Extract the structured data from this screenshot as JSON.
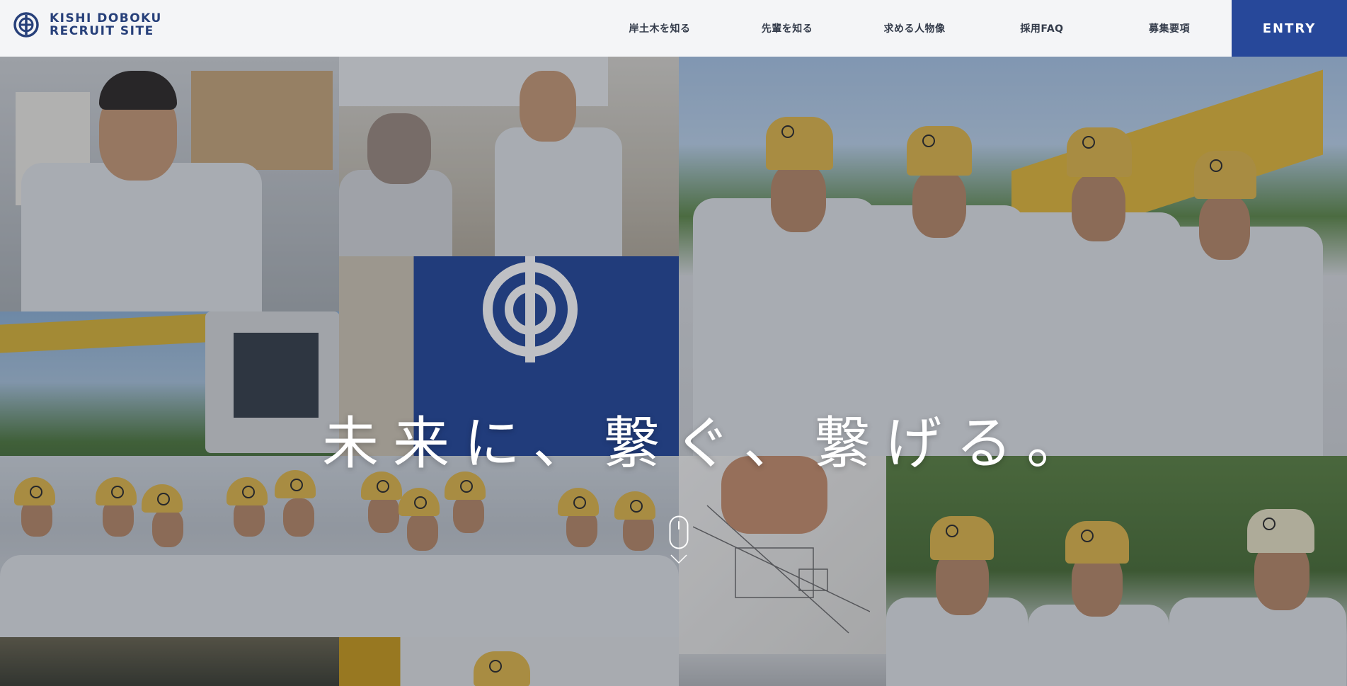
{
  "header": {
    "logo_line1": "KISHI DOBOKU",
    "logo_line2": "RECRUIT SITE",
    "nav": [
      {
        "label": "岸土木を知る"
      },
      {
        "label": "先輩を知る"
      },
      {
        "label": "求める人物像"
      },
      {
        "label": "採用FAQ"
      },
      {
        "label": "募集要項"
      }
    ],
    "entry_label": "ENTRY"
  },
  "hero": {
    "tagline": "未来に、繋ぐ、繋げる。"
  },
  "colors": {
    "brand_blue": "#27489a",
    "logo_navy": "#27407a",
    "header_bg": "#f4f5f7",
    "helmet_yellow": "#e0b84c"
  }
}
